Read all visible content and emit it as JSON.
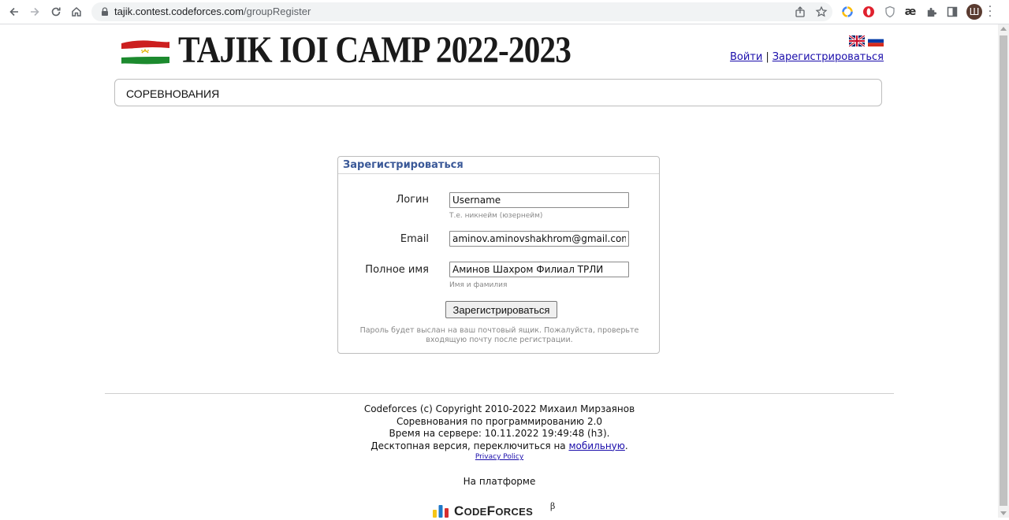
{
  "browser": {
    "url_host": "tajik.contest.codeforces.com",
    "url_path": "/groupRegister",
    "avatar_letter": "Ш",
    "icons": [
      "back-icon",
      "forward-icon",
      "reload-icon",
      "home-icon",
      "lock-icon",
      "share-icon",
      "star-icon",
      "extension-icons",
      "puzzle-icon",
      "side-panel-icon",
      "menu-icon"
    ]
  },
  "header": {
    "site_title": "TAJIK IOI CAMP 2022-2023",
    "login_link": "Войти",
    "separator": "|",
    "register_link": "Зарегистрироваться"
  },
  "menu": {
    "items": [
      "СОРЕВНОВАНИЯ"
    ]
  },
  "register": {
    "caption": "Зарегистрироваться",
    "login_label": "Логин",
    "login_value": "Username",
    "login_hint": "Т.е. никнейм (юзернейм)",
    "email_label": "Email",
    "email_value": "aminov.aminovshakhrom@gmail.com",
    "fullname_label": "Полное имя",
    "fullname_value": "Аминов Шахром Филиал ТРЛИ",
    "fullname_hint": "Имя и фамилия",
    "submit_label": "Зарегистрироваться",
    "note": "Пароль будет выслан на ваш почтовый ящик. Пожалуйста, проверьте входящую почту после регистрации."
  },
  "footer": {
    "line1": "Codeforces (c) Copyright 2010-2022 Михаил Мирзаянов",
    "line2": "Соревнования по программированию 2.0",
    "line3": "Время на сервере: 10.11.2022 19:49:48 (h3).",
    "line4_prefix": "Десктопная версия, переключиться на",
    "line4_link": "мобильную",
    "line4_suffix": ".",
    "privacy_link": "Privacy Policy",
    "platform_label": "На платформе",
    "logo_c": "C",
    "logo_ode": "ODE",
    "logo_f": "F",
    "logo_orces": "ORCES",
    "logo_beta": "β"
  },
  "colors": {
    "link": "#1a0dab",
    "caption": "#3b5998"
  }
}
